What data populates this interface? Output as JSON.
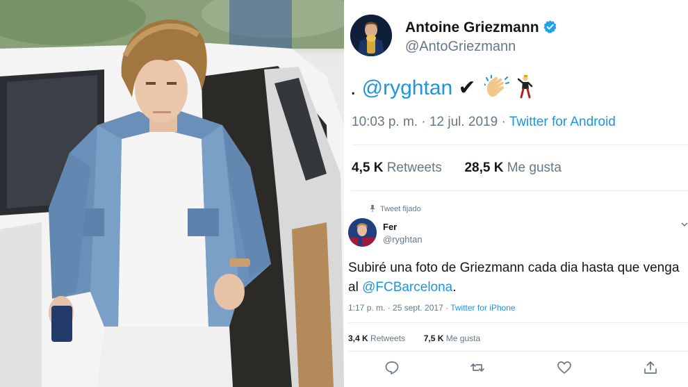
{
  "main_tweet": {
    "author_name": "Antoine Griezmann",
    "author_handle": "@AntoGriezmann",
    "text_prefix": ". ",
    "mention": "@ryghtan",
    "text_check": " ✔",
    "emoji": [
      "clapping-hands-emoji",
      "man-dancing-emoji"
    ],
    "timestamp": "10:03 p. m. · 12 jul. 2019 · ",
    "source": "Twitter for Android",
    "retweets_count": "4,5 K",
    "retweets_label": "Retweets",
    "likes_count": "28,5 K",
    "likes_label": "Me gusta"
  },
  "pinned_tweet": {
    "pinned_label": "Tweet fijado",
    "author_name": "Fer",
    "author_handle": "@ryghtan",
    "text": "Subiré una foto de Griezmann cada dia hasta que venga al ",
    "mention": "@FCBarcelona",
    "text_suffix": ".",
    "timestamp": "1:17 p. m. · 25 sept. 2017 · ",
    "source": "Twitter for iPhone",
    "retweets_count": "3,4 K",
    "retweets_label": "Retweets",
    "likes_count": "7,5 K",
    "likes_label": "Me gusta",
    "actions": [
      "reply-icon",
      "retweet-icon",
      "like-icon",
      "share-icon"
    ]
  },
  "colors": {
    "link": "#1b95e0",
    "text": "#14171a",
    "muted": "#657786",
    "divider": "#e6ecf0"
  }
}
